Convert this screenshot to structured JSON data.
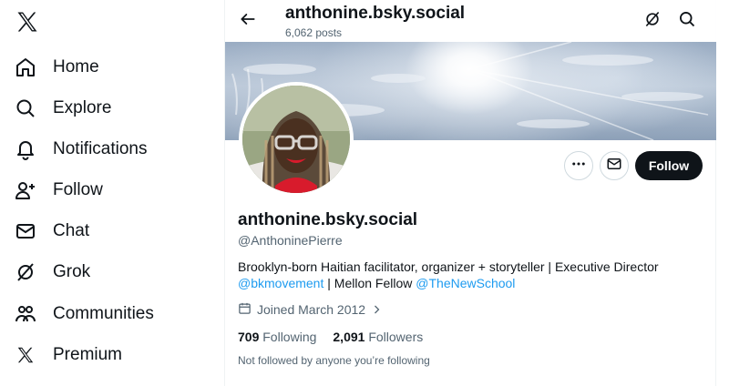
{
  "sidebar": {
    "logo": "x-logo-icon",
    "items": [
      {
        "label": "Home",
        "icon": "home-icon"
      },
      {
        "label": "Explore",
        "icon": "search-icon"
      },
      {
        "label": "Notifications",
        "icon": "bell-icon"
      },
      {
        "label": "Follow",
        "icon": "person-add-icon"
      },
      {
        "label": "Chat",
        "icon": "mail-icon"
      },
      {
        "label": "Grok",
        "icon": "grok-icon"
      },
      {
        "label": "Communities",
        "icon": "communities-icon"
      },
      {
        "label": "Premium",
        "icon": "x-logo-icon"
      }
    ]
  },
  "header": {
    "title": "anthonine.bsky.social",
    "subtitle": "6,062 posts"
  },
  "profile": {
    "name": "anthonine.bsky.social",
    "handle": "@AnthoninePierre",
    "bio_text": "Brooklyn-born Haitian facilitator, organizer + storyteller | Executive Director",
    "bio_link1": "@bkmovement",
    "bio_mid": " | Mellon Fellow ",
    "bio_link2": "@TheNewSchool",
    "joined": "Joined March 2012",
    "following_count": "709",
    "following_label": "Following",
    "followers_count": "2,091",
    "followers_label": "Followers",
    "not_followed": "Not followed by anyone you’re following"
  },
  "actions": {
    "follow_label": "Follow"
  },
  "colors": {
    "text": "#0f1419",
    "muted": "#536471",
    "link": "#1d9bf0",
    "button": "#0f1419"
  }
}
